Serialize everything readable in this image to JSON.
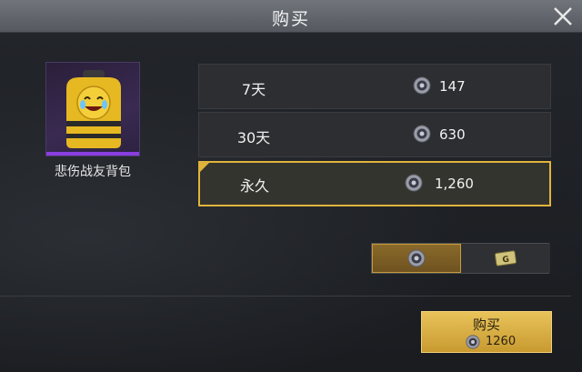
{
  "dialog": {
    "title": "购买"
  },
  "item": {
    "name": "悲伤战友背包"
  },
  "options": [
    {
      "label": "7天",
      "price": "147",
      "selected": false
    },
    {
      "label": "30天",
      "price": "630",
      "selected": false
    },
    {
      "label": "永久",
      "price": "1,260",
      "selected": true
    }
  ],
  "currency_toggle": {
    "active": "uc-coin",
    "inactive": "coupon"
  },
  "buy_button": {
    "label": "购买",
    "price": "1260"
  },
  "colors": {
    "accent": "#e0b43c",
    "rarity": "#8a3ee0"
  },
  "icons": {
    "close": "close-icon",
    "coin": "coin-icon",
    "coupon": "coupon-icon"
  }
}
